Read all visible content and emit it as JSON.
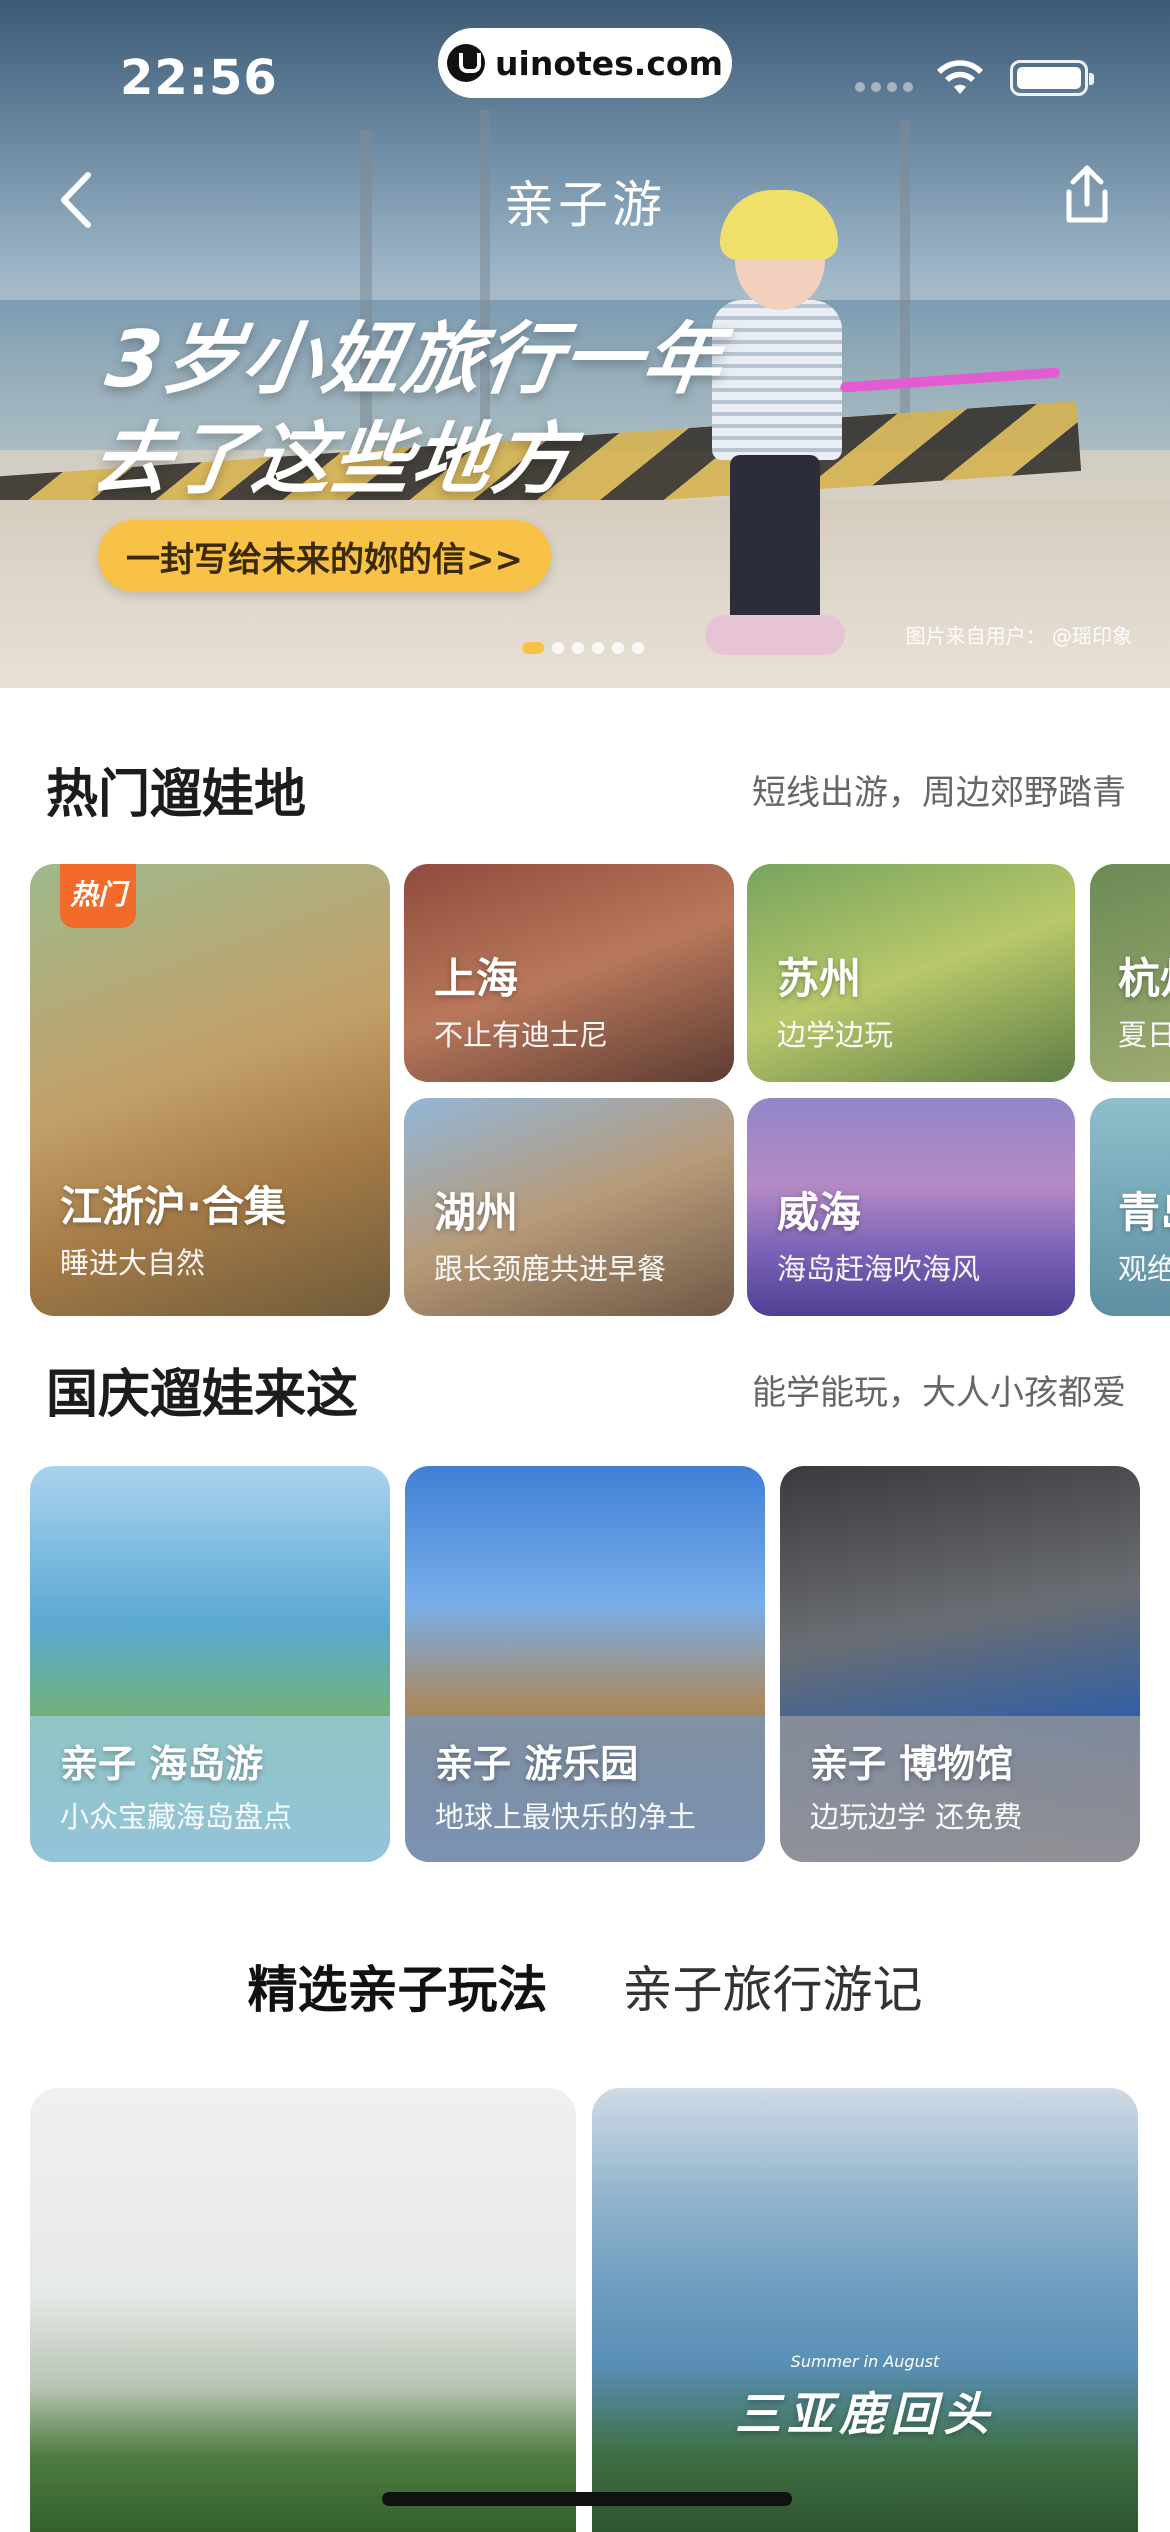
{
  "status_bar": {
    "time": "22:56",
    "url": "uinotes.com"
  },
  "nav": {
    "title": "亲子游"
  },
  "hero": {
    "headline_line1": "3岁小妞旅行一年",
    "headline_line2": "去了这些地方",
    "cta": "一封写给未来的妳的信>>",
    "credit": "图片来自用户： @瑶印象",
    "dots_total": 6,
    "dots_active_index": 0
  },
  "hot_section": {
    "title": "热门遛娃地",
    "subtitle": "短线出游，周边郊野踏青",
    "feature": {
      "badge": "热门",
      "title": "江浙沪·合集",
      "sub": "睡进大自然"
    },
    "cards": [
      {
        "title": "上海",
        "sub": "不止有迪士尼"
      },
      {
        "title": "苏州",
        "sub": "边学边玩"
      },
      {
        "title": "杭州",
        "sub": "夏日"
      },
      {
        "title": "湖州",
        "sub": "跟长颈鹿共进早餐"
      },
      {
        "title": "威海",
        "sub": "海岛赶海吹海风"
      },
      {
        "title": "青岛",
        "sub": "观绝"
      }
    ]
  },
  "national_section": {
    "title": "国庆遛娃来这",
    "subtitle": "能学能玩，大人小孩都爱",
    "cards": [
      {
        "title": "亲子 海岛游",
        "sub": "小众宝藏海岛盘点"
      },
      {
        "title": "亲子 游乐园",
        "sub": "地球上最快乐的净土"
      },
      {
        "title": "亲子 博物馆",
        "sub": "边玩边学 还免费"
      }
    ]
  },
  "tabs": [
    {
      "label": "精选亲子玩法",
      "active": true
    },
    {
      "label": "亲子旅行游记",
      "active": false
    }
  ],
  "feed": {
    "right_title": "三亚鹿回头",
    "right_subtitle": "Summer in August"
  }
}
